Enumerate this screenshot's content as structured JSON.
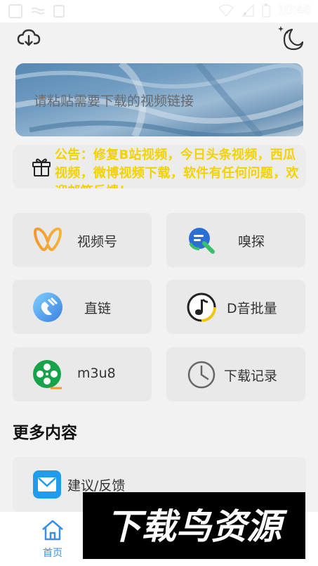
{
  "status_bar": {
    "time": "10:46"
  },
  "search": {
    "placeholder": "请粘贴需要下载的视频链接",
    "value": ""
  },
  "notice": {
    "text": "公告：修复B站视频，今日头条视频，西瓜视频，微博视频下载，软件有任何问题，欢迎邮箱反馈！"
  },
  "tiles": [
    {
      "label": "视频号",
      "icon": "wechat-channels-icon"
    },
    {
      "label": "嗅探",
      "icon": "sniff-search-icon"
    },
    {
      "label": "直链",
      "icon": "magnet-link-icon"
    },
    {
      "label": "D音批量",
      "icon": "music-note-icon"
    },
    {
      "label": "m3u8",
      "icon": "film-reel-icon"
    },
    {
      "label": "下载记录",
      "icon": "clock-icon"
    }
  ],
  "section": {
    "title": "更多内容"
  },
  "feedback": {
    "label": "建议/反馈",
    "icon": "mail-icon"
  },
  "bottom_nav": {
    "home_label": "首页"
  },
  "watermark": {
    "text": "下载鸟资源"
  },
  "colors": {
    "accent": "#3a8ee6",
    "notice": "#f2d200",
    "tile_bg": "#e9e9e9"
  }
}
